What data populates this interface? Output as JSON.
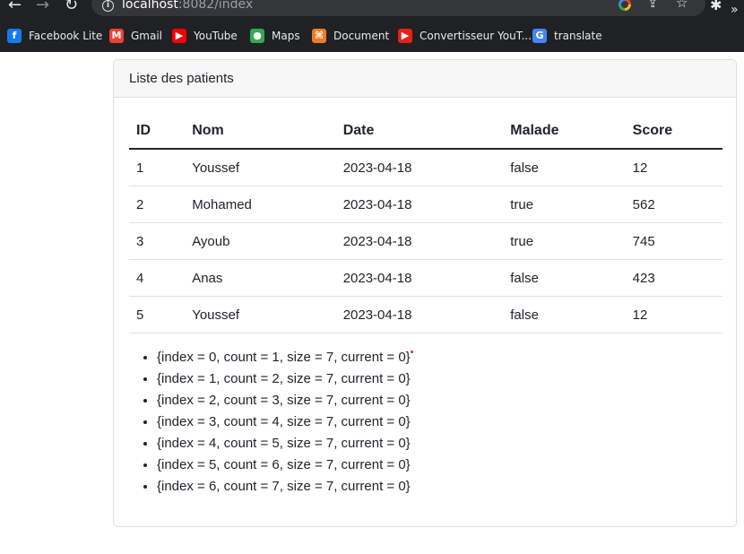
{
  "browser": {
    "url_host": "localhost",
    "url_rest": ":8082/index",
    "bookmarks": [
      {
        "label": "Facebook Lite",
        "icon": "facebook-icon",
        "color": "#1877f2",
        "glyph": "f"
      },
      {
        "label": "Gmail",
        "icon": "gmail-icon",
        "color": "#ea4335",
        "glyph": "M"
      },
      {
        "label": "YouTube",
        "icon": "youtube-icon",
        "color": "#ff0000",
        "glyph": "▶"
      },
      {
        "label": "Maps",
        "icon": "maps-icon",
        "color": "#34a853",
        "glyph": "●"
      },
      {
        "label": "Document",
        "icon": "document-icon",
        "color": "#f47b20",
        "glyph": "⌘"
      },
      {
        "label": "Convertisseur YouT...",
        "icon": "converter-icon",
        "color": "#e62117",
        "glyph": "▶"
      },
      {
        "label": "translate",
        "icon": "translate-icon",
        "color": "#4285f4",
        "glyph": "G"
      }
    ]
  },
  "card": {
    "title": "Liste des patients"
  },
  "table": {
    "headers": [
      "ID",
      "Nom",
      "Date",
      "Malade",
      "Score"
    ],
    "rows": [
      [
        "1",
        "Youssef",
        "2023-04-18",
        "false",
        "12"
      ],
      [
        "2",
        "Mohamed",
        "2023-04-18",
        "true",
        "562"
      ],
      [
        "3",
        "Ayoub",
        "2023-04-18",
        "true",
        "745"
      ],
      [
        "4",
        "Anas",
        "2023-04-18",
        "false",
        "423"
      ],
      [
        "5",
        "Youssef",
        "2023-04-18",
        "false",
        "12"
      ]
    ]
  },
  "pagination": [
    "{index = 0, count = 1, size = 7, current = 0}",
    "{index = 1, count = 2, size = 7, current = 0}",
    "{index = 2, count = 3, size = 7, current = 0}",
    "{index = 3, count = 4, size = 7, current = 0}",
    "{index = 4, count = 5, size = 7, current = 0}",
    "{index = 5, count = 6, size = 7, current = 0}",
    "{index = 6, count = 7, size = 7, current = 0}"
  ]
}
